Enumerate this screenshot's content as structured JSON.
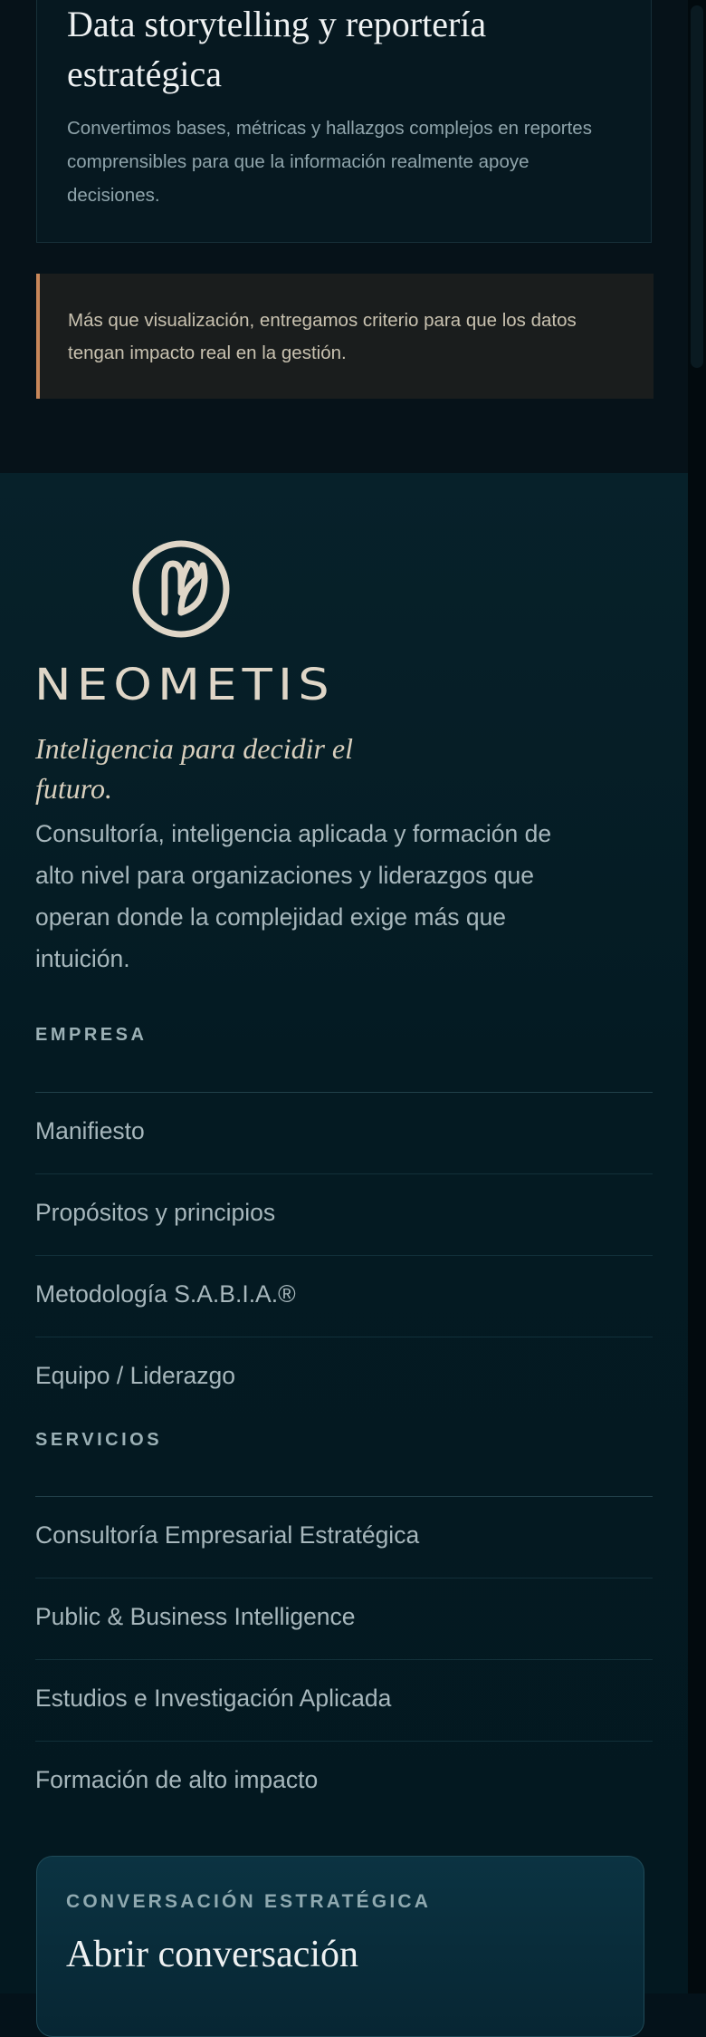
{
  "service_card": {
    "title": "Data storytelling y reportería estratégica",
    "description": "Convertimos bases, métricas y hallazgos complejos en reportes comprensibles para que la información realmente apoye decisiones."
  },
  "highlight": {
    "text": "Más que visualización, entregamos criterio para que los datos tengan impacto real en la gestión."
  },
  "footer": {
    "brand": {
      "name": "NEOMETIS",
      "tagline": "Inteligencia para decidir el futuro.",
      "description": "Consultoría, inteligencia aplicada y formación de alto nivel para organizaciones y liderazgos que operan donde la complejidad exige más que intuición."
    },
    "empresa": {
      "heading": "EMPRESA",
      "links": [
        {
          "label": "Manifiesto"
        },
        {
          "label": "Propósitos y principios"
        },
        {
          "label": "Metodología S.A.B.I.A.®"
        },
        {
          "label": "Equipo / Liderazgo"
        }
      ]
    },
    "servicios": {
      "heading": "SERVICIOS",
      "links": [
        {
          "label": "Consultoría Empresarial Estratégica"
        },
        {
          "label": "Public & Business Intelligence"
        },
        {
          "label": "Estudios e Investigación Aplicada"
        },
        {
          "label": "Formación de alto impacto"
        }
      ]
    },
    "cta": {
      "eyebrow": "CONVERSACIÓN ESTRATÉGICA",
      "title": "Abrir conversación"
    }
  },
  "colors": {
    "background": "#04121a",
    "accent_copper": "#c8875a",
    "logo_cream": "#dfd6c7",
    "link_text": "#a7b7bc",
    "heading_text": "#eef1f2"
  },
  "icons": {
    "logo_mark": "neometis-logo-icon"
  }
}
